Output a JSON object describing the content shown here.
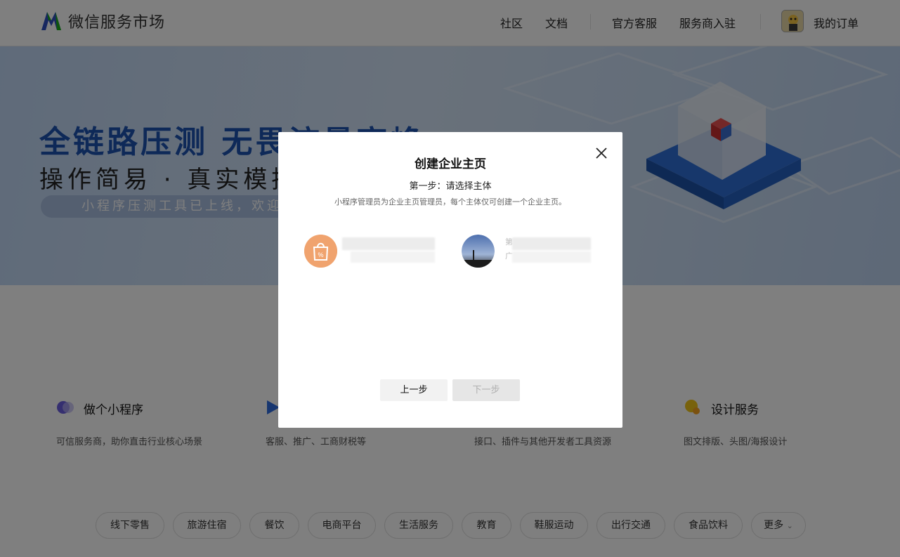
{
  "header": {
    "logo_text": "微信服务市场",
    "nav": [
      "社区",
      "文档",
      "官方客服",
      "服务商入驻"
    ],
    "orders_label": "我的订单"
  },
  "hero": {
    "title": "全链路压测  无畏流量高峰",
    "subtitle": "操作简易 · 真实模拟",
    "pill_text": "小程序压测工具已上线，欢迎"
  },
  "cards": [
    {
      "title": "做个小程序",
      "desc": "可信服务商，助你直击行业核心场景",
      "icon": "link-icon",
      "color": "#6b5fe0"
    },
    {
      "title": "",
      "desc": "客服、推广、工商财税等",
      "icon": "play-icon",
      "color": "#2f6ce0"
    },
    {
      "title": "",
      "desc": "接口、插件与其他开发者工具资源",
      "icon": "",
      "color": ""
    },
    {
      "title": "设计服务",
      "desc": "图文排版、头图/海报设计",
      "icon": "palette-icon",
      "color": "#f0c419"
    }
  ],
  "tags": [
    "线下零售",
    "旅游住宿",
    "餐饮",
    "电商平台",
    "生活服务",
    "教育",
    "鞋服运动",
    "出行交通",
    "食品饮料",
    "更多"
  ],
  "modal": {
    "title": "创建企业主页",
    "step": "第一步：请选择主体",
    "desc": "小程序管理员为企业主页管理员，每个主体仅可创建一个企业主页。",
    "prev_label": "上一步",
    "next_label": "下一步",
    "entities": [
      {
        "avatar": "shopping-bag-icon",
        "name_glyph": ""
      },
      {
        "avatar": "sunset-photo",
        "name_glyph": "第",
        "sub_glyph": "广"
      }
    ]
  },
  "colors": {
    "brand_green": "#1aad19",
    "hero_title": "#1d53b0",
    "overlay": "rgba(0,0,0,0.5)",
    "bag_orange": "#f0a36e"
  }
}
